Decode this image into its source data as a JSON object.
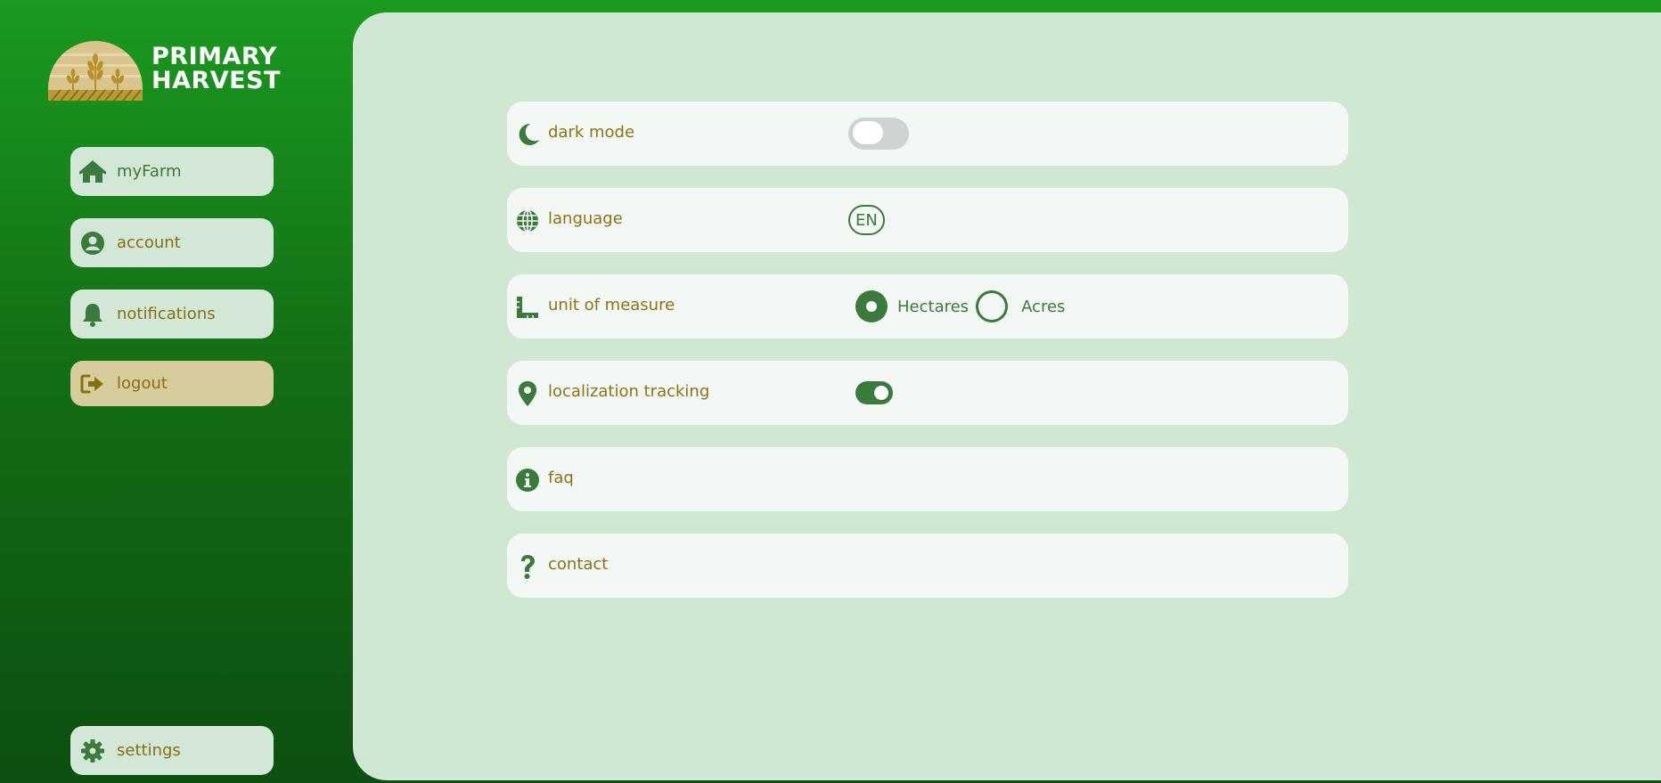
{
  "brand": {
    "line1": "PRIMARY",
    "line2": "HARVEST"
  },
  "colors": {
    "accent": "#3a7a3c",
    "label": "#8a7414",
    "sidebar_top": "#1a9a1f",
    "sidebar_bottom": "#0d4f10",
    "panel": "#d0e8d3",
    "row": "#f3f8f4",
    "logout_bg": "#d6cc9c"
  },
  "sidebar": {
    "items": [
      {
        "label": "myFarm",
        "icon": "home-icon"
      },
      {
        "label": "account",
        "icon": "user-circle-icon"
      },
      {
        "label": "notifications",
        "icon": "bell-icon"
      },
      {
        "label": "logout",
        "icon": "logout-icon"
      }
    ],
    "settings": {
      "label": "settings",
      "icon": "gear-icon"
    }
  },
  "settings": {
    "dark_mode": {
      "label": "dark mode",
      "icon": "moon-icon",
      "enabled": false
    },
    "language": {
      "label": "language",
      "icon": "globe-icon",
      "value": "EN"
    },
    "unit": {
      "label": "unit of measure",
      "icon": "ruler-icon",
      "options": [
        "Hectares",
        "Acres"
      ],
      "selected": "Hectares"
    },
    "tracking": {
      "label": "localization tracking",
      "icon": "map-pin-icon",
      "enabled": true
    },
    "faq": {
      "label": "faq",
      "icon": "info-icon"
    },
    "contact": {
      "label": "contact",
      "icon": "question-icon"
    }
  }
}
